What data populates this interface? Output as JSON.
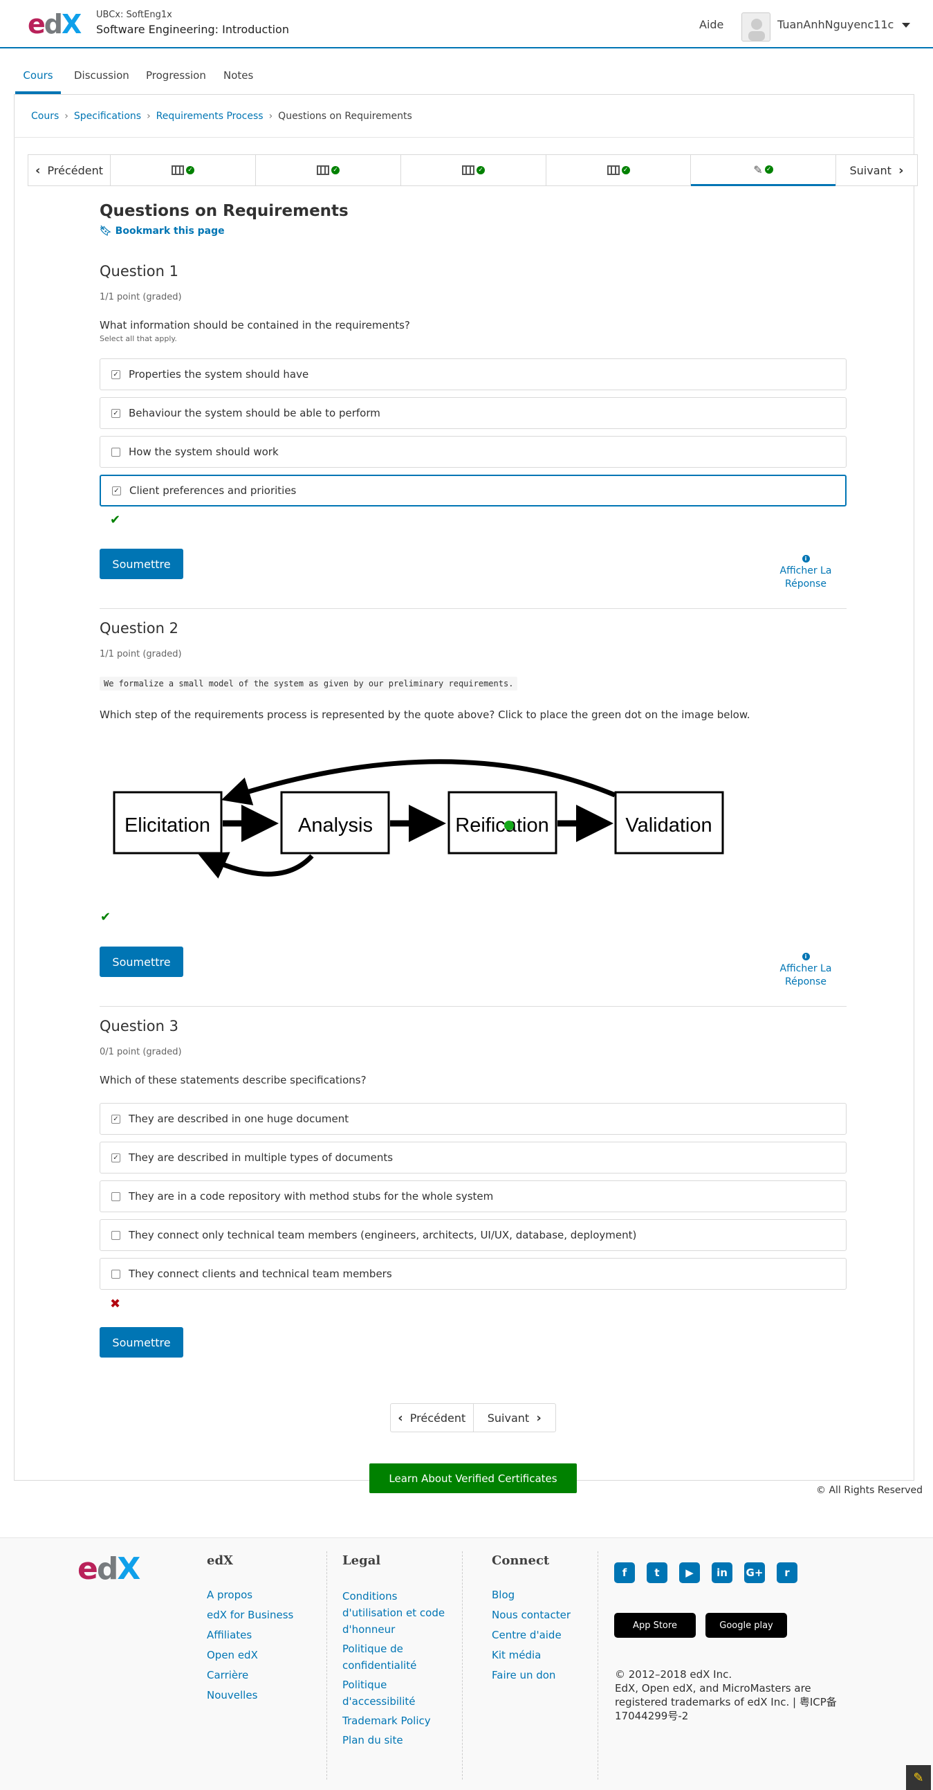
{
  "header": {
    "logo": {
      "e": "e",
      "d": "d",
      "x": "X"
    },
    "course_org": "UBCx: SoftEng1x",
    "course_title": "Software Engineering: Introduction",
    "help_link": "Aide",
    "username": "TuanAnhNguyenc11c"
  },
  "tabs": [
    "Cours",
    "Discussion",
    "Progression",
    "Notes"
  ],
  "breadcrumb": {
    "items": [
      "Cours",
      "Specifications",
      "Requirements Process",
      "Questions on Requirements"
    ],
    "sep": "›"
  },
  "sequence_nav": {
    "prev_label": "Précédent",
    "next_label": "Suivant",
    "prev_glyph": "‹",
    "next_glyph": "›",
    "check_glyph": "✓",
    "edit_glyph": "✎"
  },
  "unit": {
    "title": "Questions on Requirements",
    "bookmark": "Bookmark this page",
    "bookmark_glyph": "🔖︎"
  },
  "questions": [
    {
      "title": "Question 1",
      "score": "1/1 point (graded)",
      "text": "What information should be contained in the requirements?",
      "subtext": "Select all that apply.",
      "choices": [
        {
          "label": "Properties the system should have",
          "mark": "✓"
        },
        {
          "label": "Behaviour the system should be able to perform",
          "mark": "✓"
        },
        {
          "label": "How the system should work",
          "mark": ""
        },
        {
          "label": "Client preferences and priorities",
          "mark": "✓"
        }
      ],
      "status_glyph": "✔"
    },
    {
      "title": "Question 2",
      "score": "1/1 point (graded)",
      "quote": "We formalize a small model of the system as given by our preliminary requirements.",
      "text": "Which step of the requirements process is represented by the quote above? Click to place the green dot on the image below.",
      "diagram": {
        "boxes": [
          "Elicitation",
          "Analysis",
          "Reification",
          "Validation"
        ],
        "dot_color": "#15a81a"
      },
      "status_glyph": "✔"
    },
    {
      "title": "Question 3",
      "score": "0/1 point (graded)",
      "text": "Which of these statements describe specifications?",
      "choices": [
        {
          "label": "They are described in one huge document",
          "mark": "✓"
        },
        {
          "label": "They are described in multiple types of documents",
          "mark": "✓"
        },
        {
          "label": "They are in a code repository with method stubs for the whole system",
          "mark": ""
        },
        {
          "label": "They connect only technical team members (engineers, architects, UI/UX, database, deployment)",
          "mark": ""
        },
        {
          "label": "They connect clients and technical team members",
          "mark": ""
        }
      ],
      "status_glyph": "✖"
    }
  ],
  "buttons": {
    "submit": "Soumettre",
    "show_answer": "Afficher La Réponse",
    "info_glyph": "i"
  },
  "bottom_nav": {
    "prev": "Précédent",
    "next": "Suivant"
  },
  "cert_button": "Learn About Verified Certificates",
  "rights": "© All Rights Reserved",
  "footer": {
    "logo": {
      "e": "e",
      "d": "d",
      "x": "X"
    },
    "edx_title": "edX",
    "edx_links": [
      "A propos",
      "edX for Business",
      "Affiliates",
      "Open edX",
      "Carrière",
      "Nouvelles"
    ],
    "legal_title": "Legal",
    "legal_links": [
      "Conditions d'utilisation et code d'honneur",
      "Politique de confidentialité",
      "Politique d'accessibilité",
      "Trademark Policy",
      "Plan du site"
    ],
    "connect_title": "Connect",
    "connect_links": [
      "Blog",
      "Nous contacter",
      "Centre d'aide",
      "Kit média",
      "Faire un don"
    ],
    "social": [
      {
        "name": "facebook-icon",
        "glyph": "f"
      },
      {
        "name": "twitter-icon",
        "glyph": "t"
      },
      {
        "name": "youtube-icon",
        "glyph": "▶"
      },
      {
        "name": "linkedin-icon",
        "glyph": "in"
      },
      {
        "name": "google-plus-icon",
        "glyph": "G+"
      },
      {
        "name": "reddit-icon",
        "glyph": "r"
      }
    ],
    "app_store": "App Store",
    "google_play": "Google play",
    "copyright_line1": "© 2012–2018 edX Inc.",
    "copyright_line2": "EdX, Open edX, and MicroMasters are registered trademarks of edX Inc. | 粤ICP备17044299号-2"
  },
  "edit_corner_glyph": "✎"
}
